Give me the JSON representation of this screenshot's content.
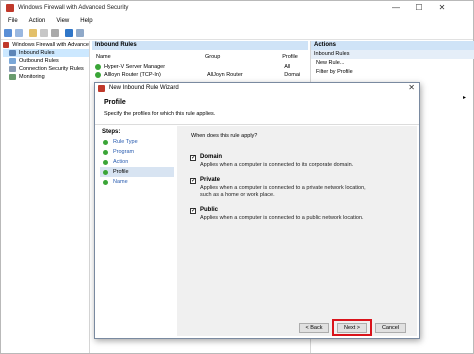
{
  "window": {
    "title": "Windows Firewall with Advanced Security",
    "controls": {
      "minimize": "—",
      "maximize": "☐",
      "close": "✕"
    }
  },
  "menu": [
    "File",
    "Action",
    "View",
    "Help"
  ],
  "tree": {
    "root": "Windows Firewall with Advance",
    "items": [
      "Inbound Rules",
      "Outbound Rules",
      "Connection Security Rules",
      "Monitoring"
    ]
  },
  "center": {
    "header": "Inbound Rules",
    "columns": {
      "name": "Name",
      "group": "Group",
      "profile": "Profile"
    },
    "rows": [
      {
        "name": "Hyper-V Server Manager",
        "group": "",
        "profile": "All"
      },
      {
        "name": "Allloyn Router (TCP-In)",
        "group": "AllJoyn Router",
        "profile": "Domai"
      }
    ]
  },
  "actions": {
    "header": "Actions",
    "sub": "Inbound Rules",
    "items": [
      "New Rule...",
      "Filter by Profile"
    ]
  },
  "dialog": {
    "title": "New Inbound Rule Wizard",
    "close": "✕",
    "heading": "Profile",
    "subheading": "Specify the profiles for which this rule applies.",
    "steps_label": "Steps:",
    "steps": [
      "Rule Type",
      "Program",
      "Action",
      "Profile",
      "Name"
    ],
    "current_step": "Profile",
    "question": "When does this rule apply?",
    "options": [
      {
        "label": "Domain",
        "checked": true,
        "desc": "Applies when a computer is connected to its corporate domain."
      },
      {
        "label": "Private",
        "checked": true,
        "desc": "Applies when a computer is connected to a private network location, such as a home or work place."
      },
      {
        "label": "Public",
        "checked": true,
        "desc": "Applies when a computer is connected to a public network location."
      }
    ],
    "buttons": {
      "back": "< Back",
      "next": "Next >",
      "cancel": "Cancel"
    }
  },
  "colors": {
    "highlight": "#d9141c",
    "selection": "#cce8ff",
    "header_blue": "#cfe3f7",
    "rule_green": "#3aa537"
  }
}
